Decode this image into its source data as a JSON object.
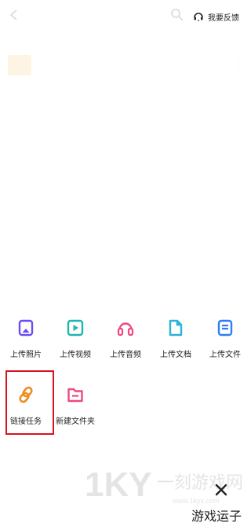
{
  "header": {
    "feedback_label": "我要反馈"
  },
  "actions_row1": [
    {
      "label": "上传照片",
      "icon": "photo-icon",
      "color": "#6a4cf0"
    },
    {
      "label": "上传视频",
      "icon": "video-icon",
      "color": "#1fb5b0"
    },
    {
      "label": "上传音频",
      "icon": "audio-icon",
      "color": "#ec4a7f"
    },
    {
      "label": "上传文档",
      "icon": "document-icon",
      "color": "#2bb3d8"
    },
    {
      "label": "上传文件",
      "icon": "file-icon",
      "color": "#2e7df6"
    }
  ],
  "actions_row2": [
    {
      "label": "链接任务",
      "icon": "link-icon",
      "color": "#f08a1c"
    },
    {
      "label": "新建文件夹",
      "icon": "new-folder-icon",
      "color": "#ec4a7f"
    }
  ],
  "close": {
    "icon": "close-icon"
  },
  "watermark": {
    "logo": "1KY",
    "title": "一刻游戏网",
    "url": "www.1kyx.com",
    "forum": "游戏运子"
  },
  "colors": {
    "highlight": "#d9121f"
  }
}
